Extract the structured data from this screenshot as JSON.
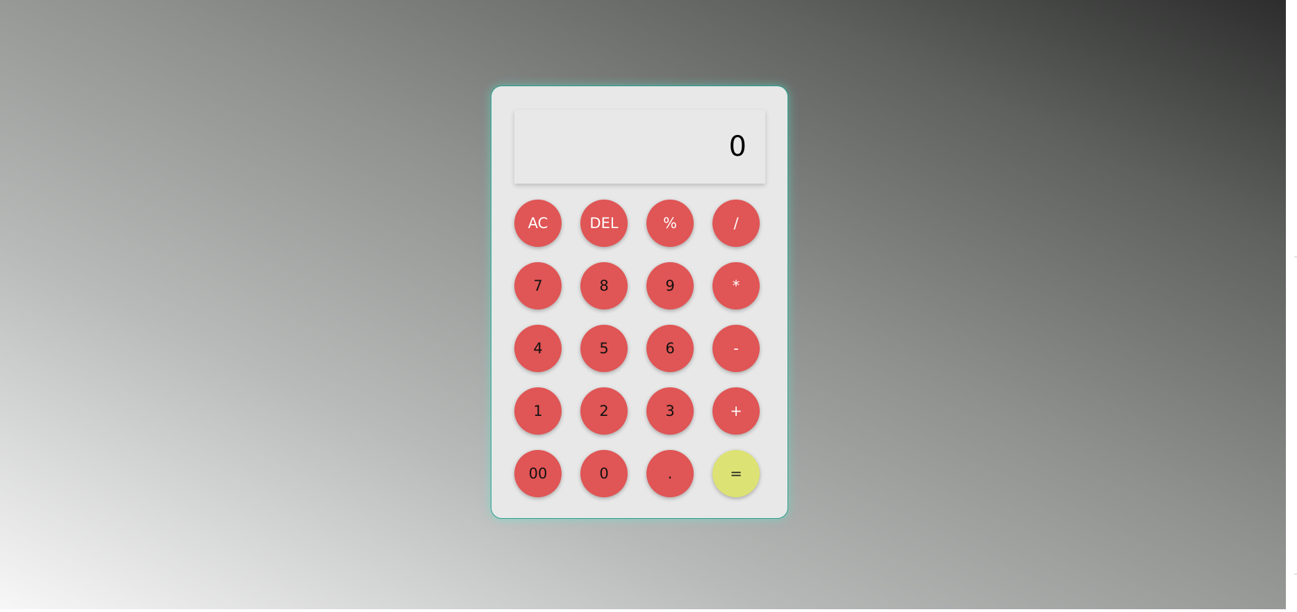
{
  "display": {
    "value": "0"
  },
  "keys": {
    "ac": "AC",
    "del": "DEL",
    "percent": "%",
    "divide": "/",
    "seven": "7",
    "eight": "8",
    "nine": "9",
    "multiply": "*",
    "four": "4",
    "five": "5",
    "six": "6",
    "minus": "-",
    "one": "1",
    "two": "2",
    "three": "3",
    "plus": "+",
    "double_zero": "00",
    "zero": "0",
    "dot": ".",
    "equals": "="
  },
  "colors": {
    "key": "#e05555",
    "equals_key": "#dde274",
    "calculator_body": "#e8e8e8",
    "calculator_border": "#2a9d8f"
  }
}
